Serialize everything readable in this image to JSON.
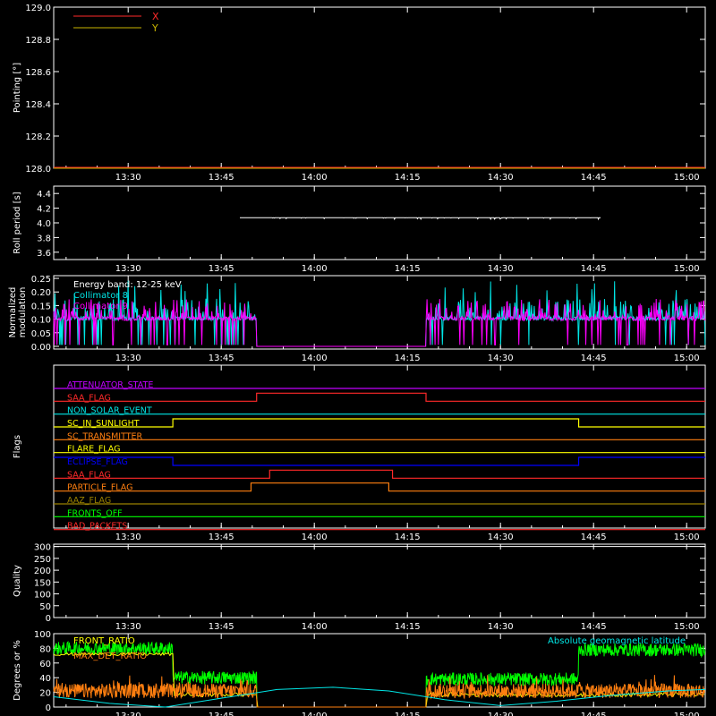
{
  "colors": {
    "background": "#000000",
    "axis": "#ffffff",
    "red": "#ff2a2a",
    "olive": "#c8b400",
    "cyan": "#00e6e6",
    "magenta": "#ff00ff",
    "orange": "#ff7f10",
    "green": "#00ff00",
    "blue": "#0000ff",
    "yellow": "#ffff00",
    "dark_olive": "#9a8000",
    "purple": "#c000ff",
    "light_gray": "#cfcfcf"
  },
  "time_axis": {
    "range_min": [
      13.3,
      15.05
    ],
    "ticks": [
      "13:30",
      "13:45",
      "14:00",
      "14:15",
      "14:30",
      "14:45",
      "15:00"
    ],
    "tick_values": [
      13.5,
      13.75,
      14.0,
      14.25,
      14.5,
      14.75,
      15.0
    ]
  },
  "chart_data": [
    {
      "id": "pointing",
      "type": "line",
      "ylabel": "Pointing [°]",
      "ylim": [
        128.0,
        129.0
      ],
      "yticks": [
        128.0,
        128.2,
        128.4,
        128.6,
        128.8,
        129.0
      ],
      "ytick_labels": [
        "128.0",
        "128.2",
        "128.4",
        "128.6",
        "128.8",
        "129.0"
      ],
      "legend": "top-left",
      "series": [
        {
          "name": "X",
          "color": "#ff2a2a",
          "x": [
            13.3,
            15.05
          ],
          "y": [
            128.0,
            128.0
          ]
        },
        {
          "name": "Y",
          "color": "#c8b400",
          "x": [
            13.3,
            15.05
          ],
          "y": [
            128.0,
            128.0
          ]
        }
      ]
    },
    {
      "id": "roll",
      "type": "line",
      "ylabel": "Roll period [s]",
      "ylim": [
        3.5,
        4.5
      ],
      "yticks": [
        3.6,
        3.8,
        4.0,
        4.2,
        4.4
      ],
      "ytick_labels": [
        "3.6",
        "3.8",
        "4.0",
        "4.2",
        "4.4"
      ],
      "series": [
        {
          "name": "",
          "color": "#ffffff",
          "x": [
            13.8,
            14.77
          ],
          "y": [
            4.07,
            4.07
          ]
        }
      ]
    },
    {
      "id": "modulation",
      "type": "line",
      "ylabel": "Normalized modulation",
      "ylim": [
        -0.01,
        0.26
      ],
      "yticks": [
        0.0,
        0.05,
        0.1,
        0.15,
        0.2,
        0.25
      ],
      "ytick_labels": [
        "0.00",
        "0.05",
        "0.10",
        "0.15",
        "0.20",
        "0.25"
      ],
      "legend": "top-left",
      "annotation": "Energy band: 12-25 keV",
      "series": [
        {
          "name": "Collimator 8",
          "color": "#00e6e6",
          "base_level": 0.095,
          "gap": [
            13.845,
            14.3
          ]
        },
        {
          "name": "Collimator 9",
          "color": "#ff00ff",
          "base_level": 0.095,
          "gap": [
            13.845,
            14.3
          ]
        }
      ]
    },
    {
      "id": "flags",
      "type": "line",
      "ylabel": "Flags",
      "flags": [
        {
          "name": "ATTENUATOR_STATE",
          "color": "#c000ff",
          "segments": []
        },
        {
          "name": "SAA_FLAG",
          "color": "#ff2a2a",
          "segments": [
            [
              13.845,
              14.3
            ]
          ]
        },
        {
          "name": "NON_SOLAR_EVENT",
          "color": "#00e6e6",
          "segments": []
        },
        {
          "name": "SC_IN_SUNLIGHT",
          "color": "#ffff00",
          "segments": [
            [
              13.62,
              14.71
            ]
          ]
        },
        {
          "name": "SC_TRANSMITTER",
          "color": "#ff7f10",
          "segments": []
        },
        {
          "name": "FLARE_FLAG",
          "color": "#ffff00",
          "segments": []
        },
        {
          "name": "ECLIPSE_FLAG",
          "color": "#0000ff",
          "segments": [
            [
              13.3,
              13.62
            ],
            [
              14.71,
              15.05
            ]
          ],
          "negative": true
        },
        {
          "name": "SAA_FLAG",
          "color": "#ff2a2a",
          "segments": [
            [
              13.88,
              14.21
            ]
          ]
        },
        {
          "name": "PARTICLE_FLAG",
          "color": "#ff7f10",
          "segments": [
            [
              13.83,
              14.2
            ]
          ]
        },
        {
          "name": "AAZ_FLAG",
          "color": "#9a8000",
          "segments": []
        },
        {
          "name": "FRONTS_OFF",
          "color": "#00ff00",
          "segments": []
        },
        {
          "name": "BAD_PACKETS",
          "color": "#ff2a2a",
          "segments": []
        }
      ]
    },
    {
      "id": "quality",
      "type": "line",
      "ylabel": "Quality",
      "ylim": [
        0,
        310
      ],
      "yticks": [
        0,
        50,
        100,
        150,
        200,
        250,
        300
      ],
      "ytick_labels": [
        "0",
        "50",
        "100",
        "150",
        "200",
        "250",
        "300"
      ],
      "series": [
        {
          "name": "",
          "color": "#ffffff",
          "x": [
            13.3,
            15.05
          ],
          "y": [
            300,
            300
          ]
        }
      ]
    },
    {
      "id": "ratios",
      "type": "line",
      "ylabel": "Degrees or %",
      "ylim": [
        0,
        100
      ],
      "yticks": [
        0,
        20,
        40,
        60,
        80,
        100
      ],
      "ytick_labels": [
        "0",
        "20",
        "40",
        "60",
        "80",
        "100"
      ],
      "legend": "top-left",
      "series": [
        {
          "name": "FRONT_RATIO",
          "color": "#ffff00"
        },
        {
          "name": "MAX_DET_RATIO",
          "color": "#ff7f10"
        },
        {
          "name": "Absolute geomagnetic latitude",
          "color": "#00e6e6",
          "x": [
            13.3,
            13.45,
            13.6,
            13.75,
            13.9,
            14.05,
            14.2,
            14.35,
            14.5,
            14.65,
            14.8,
            14.95,
            15.05
          ],
          "y": [
            14,
            5,
            0,
            12,
            24,
            27,
            22,
            10,
            2,
            8,
            16,
            22,
            24
          ]
        }
      ],
      "green_level_segments": [
        [
          13.3,
          13.62,
          80
        ],
        [
          13.62,
          13.845,
          40
        ],
        [
          14.3,
          14.71,
          38
        ],
        [
          14.71,
          15.05,
          78
        ]
      ],
      "gap": [
        13.845,
        14.3
      ]
    }
  ]
}
